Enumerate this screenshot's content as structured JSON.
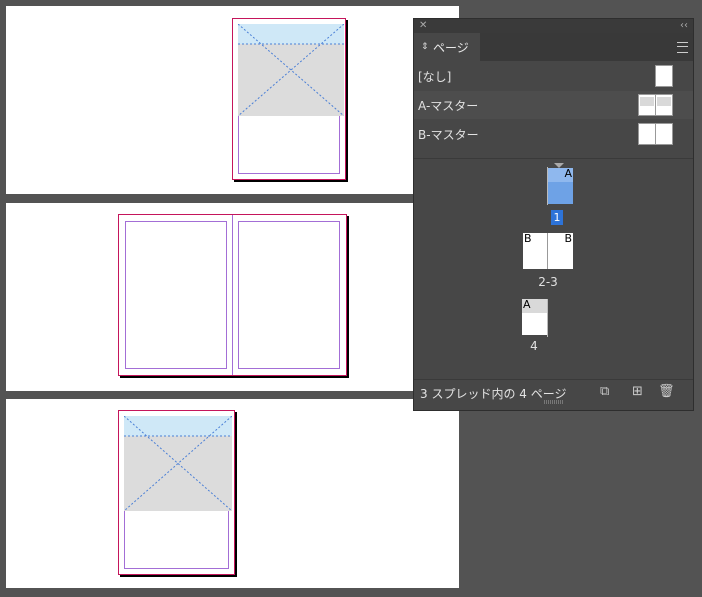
{
  "panel": {
    "tab_label": "ページ",
    "tab_updown_icon": "⇕",
    "close_icon": "✕",
    "collapse_icon": "‹‹",
    "menu_icon": "panel-menu-icon"
  },
  "masters": [
    {
      "label": "[なし]"
    },
    {
      "label": "A-マスター"
    },
    {
      "label": "B-マスター"
    }
  ],
  "pages": {
    "page1": {
      "number": "1",
      "master_letter": "A"
    },
    "spread23": {
      "label": "2-3",
      "left_letter": "B",
      "right_letter": "B"
    },
    "page4": {
      "label": "4",
      "master_letter": "A"
    }
  },
  "status": {
    "text": "3 スプレッド内の 4 ページ"
  },
  "colors": {
    "selection": "#2d73d8",
    "thumb_selected": "#6ea2e6",
    "page_border": "#c5155b",
    "margin_guide": "#a36ed6",
    "frame_band": "#cfe8f7"
  }
}
